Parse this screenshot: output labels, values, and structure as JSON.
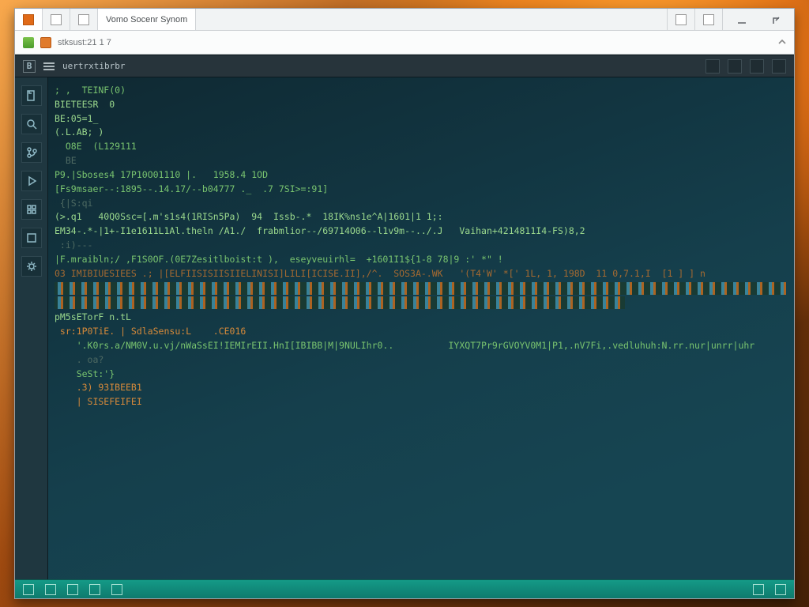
{
  "window": {
    "title": "Vomo  Socenr Synom"
  },
  "addressbar": {
    "path": "stksust:21 1 7"
  },
  "editor": {
    "tab_label": "uertrxtibrbr",
    "activity_icons": [
      "files",
      "search",
      "branch",
      "debug",
      "boxes",
      "grid",
      "gear"
    ],
    "toolbar_icons": [
      "panel",
      "split",
      "more",
      "menu"
    ]
  },
  "code_lines": [
    {
      "c": "g",
      "t": "; ,  TEINF(0)"
    },
    {
      "c": "g2",
      "t": "BIETEESR  0"
    },
    {
      "c": "g2",
      "t": "BE:05=1_"
    },
    {
      "c": "g2",
      "t": "(.L.AB; )"
    },
    {
      "c": "g",
      "t": "  O8E  (L129111"
    },
    {
      "c": "dim",
      "t": "  BE"
    },
    {
      "c": "g",
      "t": "P9.|Sboses4 17P10O01110 |.   1958.4 1OD"
    },
    {
      "c": "g",
      "t": "[Fs9msaer--:1895--.14.17/--b04777 ._  .7 7SI>=:91]"
    },
    {
      "c": "dim",
      "t": " {|S:qi"
    },
    {
      "c": "g2",
      "t": "(>.q1   40Q0Ssc=[.m's1s4(1RISn5Pa)  94  Issb-.*  18IK%ns1e^A|1601|1 1;:"
    },
    {
      "c": "g2",
      "t": "EM34-.*-|1+-I1e1611L1Al.theln /A1./  frabmlior--/69714O06--l1v9m--../.J   Vaihan+4214811I4-FS)8,2"
    },
    {
      "c": "dim",
      "t": " :i)---"
    },
    {
      "c": "g",
      "t": "|F.mraibln;/ ,F1S0OF.(0E7Zesitlboist:t ),  eseyveuirhl=  +1601I1${1-8 78|9 :' *\" !"
    },
    {
      "c": "br",
      "t": "03 IMIBIUESIEES .; |[ELFIISISIISIIELINISI]LILI[ICISE.II],/^.  SOS3A-.WK   '(T4'W' *[' 1L, 1, 198D  11 0,7.1,I  [1 ] ] n"
    },
    {
      "c": "",
      "t": "@@STRIPE@@"
    },
    {
      "c": "",
      "t": "@@STRIPE_MID@@"
    },
    {
      "c": "g2",
      "t": "pM5sETorF n.tL"
    },
    {
      "c": "or",
      "t": " sr:1P0TiE. | SdlaSensu:L    .CE016"
    },
    {
      "c": "g",
      "t": "    '.K0rs.a/NM0V.u.vj/nWaSsEI!IEMIrEII.HnI[IBIBB|M|9NULIhr0..          IYXQT7Pr9rGVOYV0M1|P1,.nV7Fi,.vedluhuh:N.rr.nur|unrr|uhr"
    },
    {
      "c": "dim",
      "t": "    . oa?"
    },
    {
      "c": "g",
      "t": "    SeSt:'}"
    },
    {
      "c": "or",
      "t": "    .3) 93IBEEB1"
    },
    {
      "c": "or",
      "t": "    | SISEFEIFEI"
    }
  ],
  "status": {
    "items": [
      "",
      "",
      "",
      "",
      ""
    ],
    "right": [
      "",
      ""
    ]
  }
}
